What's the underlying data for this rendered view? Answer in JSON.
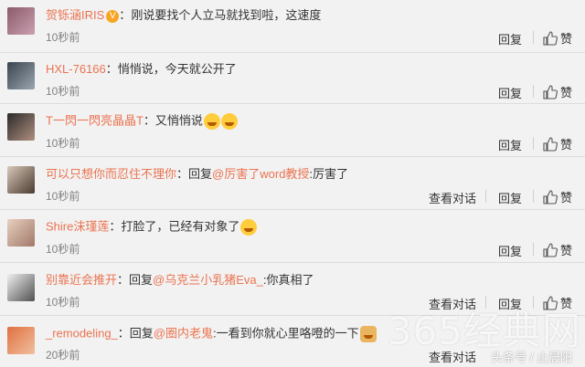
{
  "colors": {
    "accent": "#eb7350",
    "text": "#333333",
    "muted": "#808080",
    "bg": "#f2f2f2"
  },
  "icons": {
    "like": "thumbs-up-icon",
    "verified": "verified-badge-icon",
    "emoji": "emoji-icon"
  },
  "labels": {
    "reply": "回复",
    "like": "赞",
    "view_dialog": "查看对话"
  },
  "comments": [
    {
      "user": "贺铄涵IRIS",
      "badge": "V",
      "colon": "：",
      "text": "刚说要找个人立马就找到啦，这速度",
      "time": "10秒前"
    },
    {
      "user": "HXL-76166",
      "colon": "：",
      "text": "悄悄说，今天就公开了",
      "time": "10秒前"
    },
    {
      "user": "T一閃一閃亮晶晶T",
      "colon": "：",
      "text": "又悄悄说",
      "time": "10秒前"
    },
    {
      "user": "可以只想你而忍住不理你",
      "colon": "：",
      "reply_prefix": "回复",
      "mention": "@厉害了word教授",
      "text": ":厉害了",
      "time": "10秒前"
    },
    {
      "user": "Shire沫瑾莲",
      "colon": "：",
      "text": "打脸了，已经有对象了",
      "time": "10秒前"
    },
    {
      "user": "别靠近会推开",
      "colon": "：",
      "reply_prefix": "回复",
      "mention": "@乌克兰小乳猪Eva_",
      "text": ":你真相了",
      "time": "10秒前"
    },
    {
      "user": "_remodeling_",
      "colon": "：",
      "reply_prefix": "回复",
      "mention": "@圈内老鬼",
      "text": ":一看到你就心里咯噔的一下",
      "time": "20秒前"
    }
  ],
  "watermark": "365经典网",
  "source_text": "头条号 / 止晨阳"
}
